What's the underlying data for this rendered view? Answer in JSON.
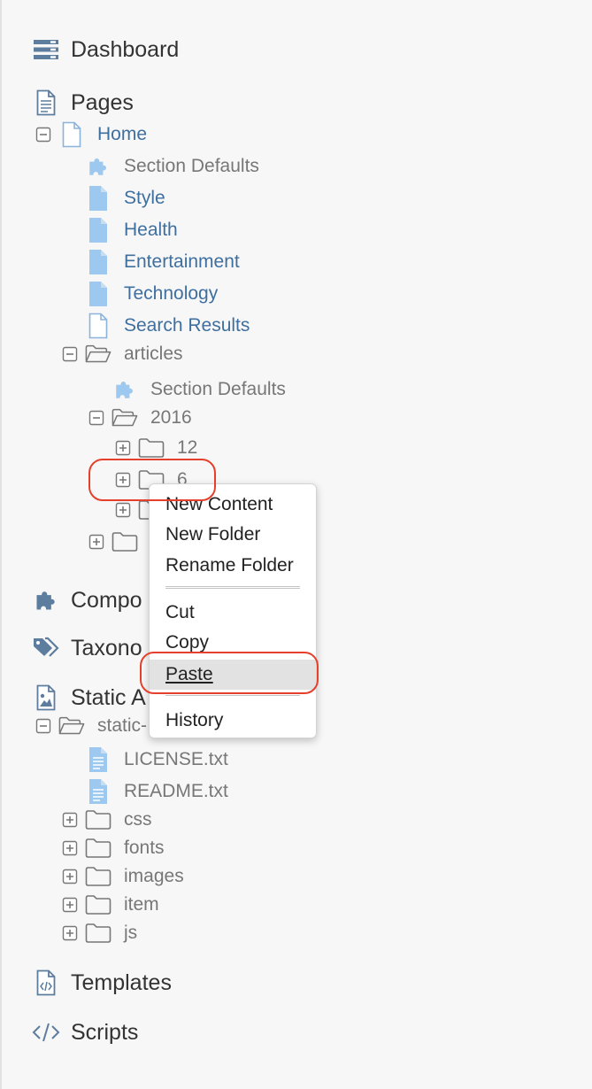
{
  "colors": {
    "icon_blue": "#9dc8ef",
    "icon_outline": "#8cb3da",
    "nav_icon": "#5d7d9f",
    "link": "#3f6f9f",
    "muted": "#777777",
    "annotation": "#e5402b"
  },
  "nav": {
    "dashboard": "Dashboard",
    "pages": "Pages",
    "components": "Compo",
    "taxonomy": "Taxono",
    "static_assets": "Static A",
    "templates": "Templates",
    "scripts": "Scripts"
  },
  "pages_tree": {
    "home": "Home",
    "section_defaults": "Section Defaults",
    "style": "Style",
    "health": "Health",
    "entertainment": "Entertainment",
    "technology": "Technology",
    "search_results": "Search Results",
    "articles": "articles",
    "articles_section_defaults": "Section Defaults",
    "year_2016": "2016",
    "month_12": "12",
    "month_6": "6"
  },
  "static_tree": {
    "static_root": "static-",
    "license": "LICENSE.txt",
    "readme": "README.txt",
    "css": "css",
    "fonts": "fonts",
    "images": "images",
    "item": "item",
    "js": "js"
  },
  "context_menu": {
    "new_content": "New Content",
    "new_folder": "New Folder",
    "rename_folder": "Rename Folder",
    "cut": "Cut",
    "copy": "Copy",
    "paste": "Paste",
    "history": "History",
    "highlighted_item": "Paste"
  }
}
